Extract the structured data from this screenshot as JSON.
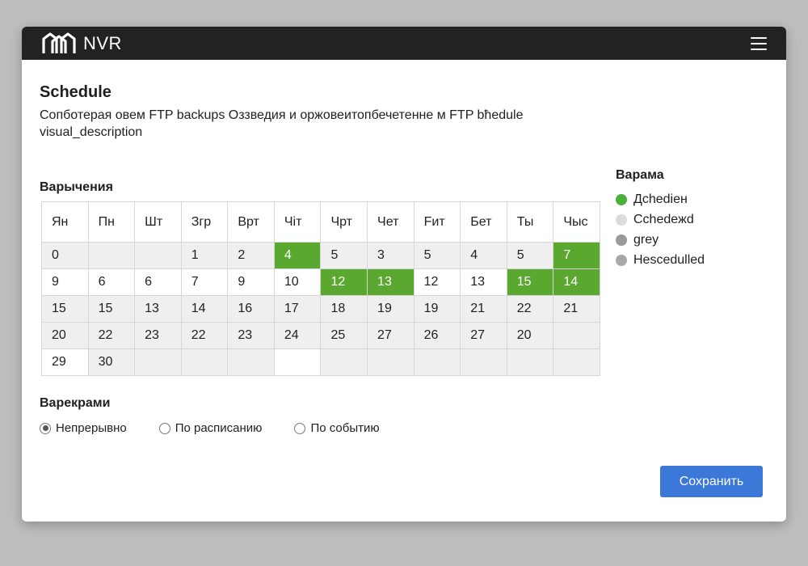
{
  "app": {
    "name": "NVR"
  },
  "page": {
    "title": "Schedule",
    "description_lines": [
      "Сопботерая овем FTP backups Оззведия и оржовеитопбечетенне м FTP bћedule",
      "visual_description"
    ]
  },
  "grid": {
    "label": "Варычения",
    "headers": [
      "Ян",
      "Пн",
      "Шт",
      "Згр",
      "Врт",
      "Чіт",
      "Чрт",
      "Чет",
      "Fит",
      "Бет",
      "Ты",
      "Чыс"
    ],
    "rows": [
      [
        "0",
        "",
        "",
        "1",
        "2",
        "4",
        "5",
        "3",
        "5",
        "4",
        "5",
        "7"
      ],
      [
        "9",
        "6",
        "6",
        "7",
        "9",
        "10",
        "12",
        "13",
        "12",
        "13",
        "15",
        "14"
      ],
      [
        "15",
        "15",
        "13",
        "14",
        "16",
        "17",
        "18",
        "19",
        "19",
        "21",
        "22",
        "21"
      ],
      [
        "20",
        "22",
        "23",
        "22",
        "23",
        "24",
        "25",
        "27",
        "26",
        "27",
        "20",
        ""
      ],
      [
        "29",
        "30",
        "",
        "",
        "",
        "",
        "",
        "",
        "",
        "",
        "",
        ""
      ]
    ],
    "active_cells": [
      [
        0,
        5
      ],
      [
        0,
        11
      ],
      [
        1,
        6
      ],
      [
        1,
        7
      ],
      [
        1,
        10
      ],
      [
        1,
        11
      ]
    ],
    "white_cells": [
      [
        1,
        0
      ],
      [
        1,
        1
      ],
      [
        1,
        2
      ],
      [
        1,
        3
      ],
      [
        1,
        4
      ],
      [
        1,
        5
      ],
      [
        1,
        8
      ],
      [
        1,
        9
      ],
      [
        4,
        0
      ],
      [
        4,
        5
      ]
    ]
  },
  "legend": {
    "title": "Варама",
    "items": [
      {
        "label": "Дchedieн",
        "color": "#4caf3a"
      },
      {
        "label": "Cchedeжd",
        "color": "#dcdcdc"
      },
      {
        "label": "grey",
        "color": "#9a9a9a"
      },
      {
        "label": "Hescedulled",
        "color": "#a8a8a8"
      }
    ]
  },
  "mode": {
    "title": "Варекрами",
    "options": [
      {
        "label": "Непрерывно",
        "checked": true
      },
      {
        "label": "По расписанию",
        "checked": false
      },
      {
        "label": "По событию",
        "checked": false
      }
    ]
  },
  "actions": {
    "save_label": "Сохранить"
  },
  "colors": {
    "accent": "#3b78d8",
    "active_cell": "#5aa82f",
    "titlebar": "#222222"
  }
}
